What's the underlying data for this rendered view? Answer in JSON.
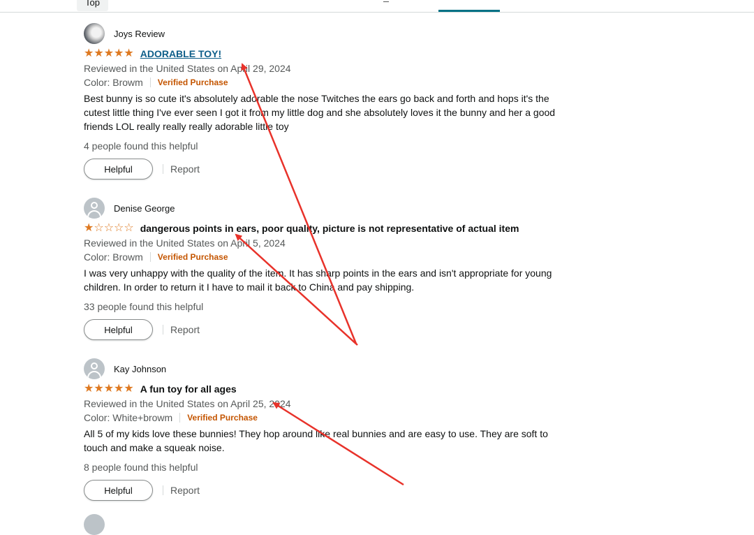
{
  "top": {
    "tab_label": "Top"
  },
  "reviews": [
    {
      "name": "Joys Review",
      "avatar": "photo",
      "rating": 5,
      "title": "ADORABLE TOY!",
      "title_link": true,
      "date": "Reviewed in the United States on April 29, 2024",
      "color": "Color: Browm",
      "verified": "Verified Purchase",
      "body": "Best bunny is so cute it's absolutely adorable the nose Twitches the ears go back and forth and hops it's the cutest little thing I've ever seen I got it from my little dog and she absolutely loves it the bunny and her a good friends LOL really really really adorable little toy",
      "helpful_count": "4 people found this helpful",
      "helpful_label": "Helpful",
      "report_label": "Report"
    },
    {
      "name": "Denise George",
      "avatar": "default",
      "rating": 1,
      "title": "dangerous points in ears, poor quality, picture is not representative of actual item",
      "title_link": false,
      "date": "Reviewed in the United States on April 5, 2024",
      "color": "Color: Browm",
      "verified": "Verified Purchase",
      "body": "I was very unhappy with the quality of the item. It has sharp points in the ears and isn't appropriate for young children. In order to return it I have to mail it back to China and pay shipping.",
      "helpful_count": "33 people found this helpful",
      "helpful_label": "Helpful",
      "report_label": "Report"
    },
    {
      "name": "Kay Johnson",
      "avatar": "default",
      "rating": 5,
      "title": "A fun toy for all ages",
      "title_link": false,
      "date": "Reviewed in the United States on April 25, 2024",
      "color": "Color: White+browm",
      "verified": "Verified Purchase",
      "body": "All 5 of my kids love these bunnies! They hop around like real bunnies and are easy to use. They are soft to touch and make a squeak noise.",
      "helpful_count": "8 people found this helpful",
      "helpful_label": "Helpful",
      "report_label": "Report"
    }
  ],
  "colors": {
    "star": "#de7921",
    "verified": "#c45500",
    "link": "#0f5f8a",
    "annotation_arrow": "#e8322a"
  },
  "icons": {
    "star_full": "star-icon",
    "star_empty": "star-outline-icon",
    "avatar": "user-avatar-icon"
  }
}
